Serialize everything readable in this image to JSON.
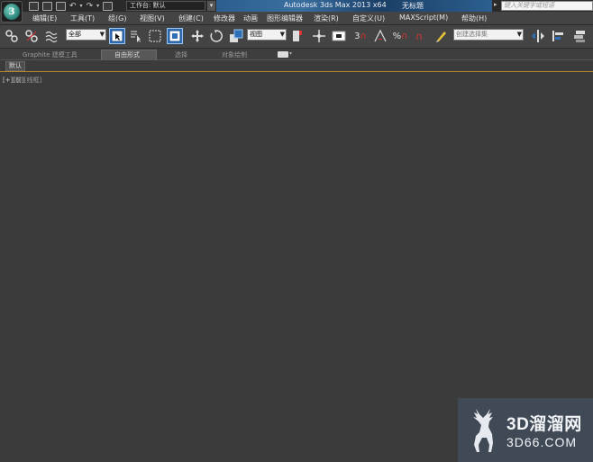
{
  "titlebar": {
    "workspace_label": "工作台: 默认",
    "app_title": "Autodesk 3ds Max  2013 x64",
    "document_name": "无标题",
    "search_placeholder": "键入关键字或短语"
  },
  "menu": {
    "items": [
      "编辑(E)",
      "工具(T)",
      "组(G)",
      "视图(V)",
      "创建(C)",
      "修改器",
      "动画",
      "图形编辑器",
      "渲染(R)",
      "自定义(U)",
      "MAXScript(M)",
      "帮助(H)"
    ]
  },
  "toolbar": {
    "selection_filter": "全部",
    "reference_coord": "视图",
    "named_selection": "创建选择集",
    "snap_label": "3",
    "angle_snap_label": "%"
  },
  "ribbon": {
    "tabs": [
      "Graphite 建模工具",
      "自由形式",
      "选择",
      "对象绘制"
    ],
    "active_tab": "自由形式",
    "panel_label": "默认"
  },
  "viewport": {
    "label_plus": "[+]",
    "label_view": "[前]",
    "label_shading": "[线框]"
  },
  "watermark": {
    "main_text": "3D溜溜网",
    "url_text": "3D66.COM"
  },
  "colors": {
    "background": "#3b3b3b",
    "title_banner": "#2c5f8f",
    "selected_tool": "#2f6fb8",
    "ribbon_accent": "#b8862c"
  }
}
